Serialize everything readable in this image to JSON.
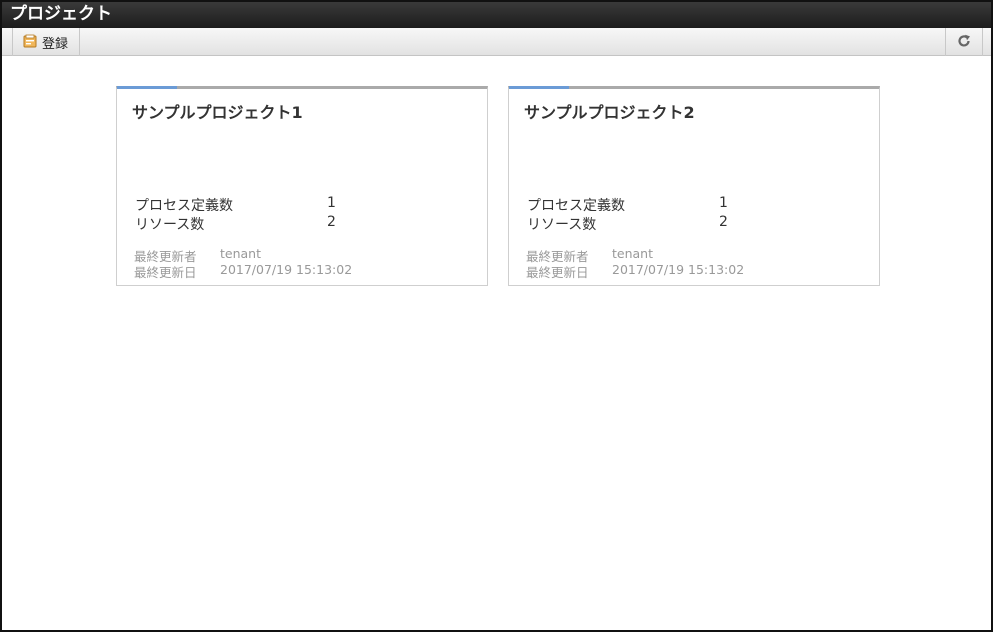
{
  "window": {
    "title": "プロジェクト"
  },
  "toolbar": {
    "register_label": "登録",
    "register_icon": "register-icon",
    "refresh_icon": "refresh-icon"
  },
  "colors": {
    "accent": "#6b9bd6",
    "titlebar": "#222222"
  },
  "projects": [
    {
      "title": "サンプルプロジェクト1",
      "process_label": "プロセス定義数",
      "process_count": "1",
      "resource_label": "リソース数",
      "resource_count": "2",
      "updater_label": "最終更新者",
      "updater": "tenant",
      "updated_label": "最終更新日",
      "updated_at": "2017/07/19 15:13:02"
    },
    {
      "title": "サンプルプロジェクト2",
      "process_label": "プロセス定義数",
      "process_count": "1",
      "resource_label": "リソース数",
      "resource_count": "2",
      "updater_label": "最終更新者",
      "updater": "tenant",
      "updated_label": "最終更新日",
      "updated_at": "2017/07/19 15:13:02"
    }
  ]
}
